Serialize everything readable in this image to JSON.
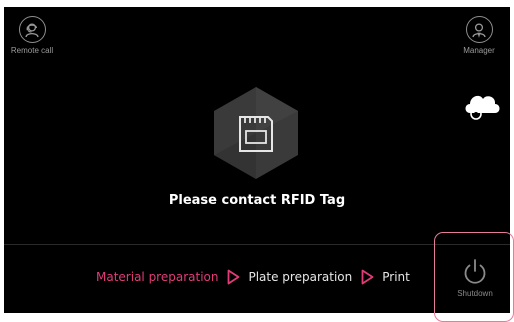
{
  "top_left": {
    "label": "Remote call",
    "icon": "remote-call-icon"
  },
  "top_right": {
    "label": "Manager",
    "icon": "manager-icon"
  },
  "cloud": {
    "icon": "cloud-icon"
  },
  "center": {
    "icon": "sd-card-icon",
    "message": "Please contact RFID Tag"
  },
  "steps": [
    {
      "label": "Material preparation",
      "state": "active"
    },
    {
      "label": "Plate preparation",
      "state": "inactive"
    },
    {
      "label": "Print",
      "state": "inactive"
    }
  ],
  "shutdown": {
    "label": "Shutdown",
    "icon": "power-icon"
  },
  "colors": {
    "background": "#000000",
    "accent": "#e03c78",
    "text": "#ffffff",
    "muted": "#9a9a9a",
    "hexagon": "#3a3a3a"
  }
}
